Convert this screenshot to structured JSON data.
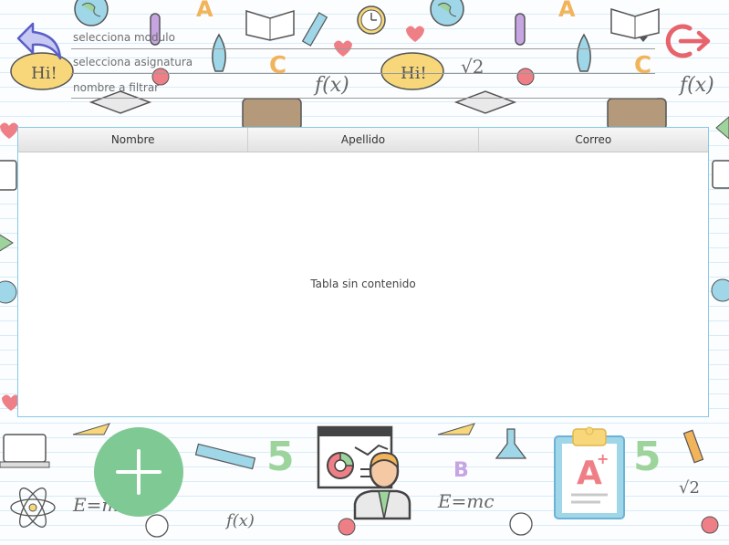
{
  "form": {
    "module_placeholder": "selecciona modulo",
    "subject_placeholder": "selecciona asignatura",
    "filter_placeholder": "nombre a filtrar",
    "filter_value": ""
  },
  "table": {
    "columns": [
      "Nombre",
      "Apellido",
      "Correo"
    ],
    "rows": [],
    "empty_text": "Tabla sin contenido"
  },
  "doodles": {
    "hi_text": "Hi!",
    "fx_text": "f(x)",
    "emc_text": "E=mc",
    "sqrt_text": "√2",
    "five_text": "5",
    "letter_a": "A",
    "letter_b": "B",
    "letter_c": "C",
    "grade_text": "A",
    "plus_text": "+"
  },
  "icons": {
    "back": "back-arrow-icon",
    "logout": "logout-icon",
    "add": "add-icon",
    "teacher": "teacher-presentation-icon",
    "grade": "grade-report-icon"
  },
  "colors": {
    "add_green": "#7ec994",
    "logout_red": "#e8636b",
    "back_purple": "#5a5fc8",
    "table_border": "#86c9e6"
  }
}
